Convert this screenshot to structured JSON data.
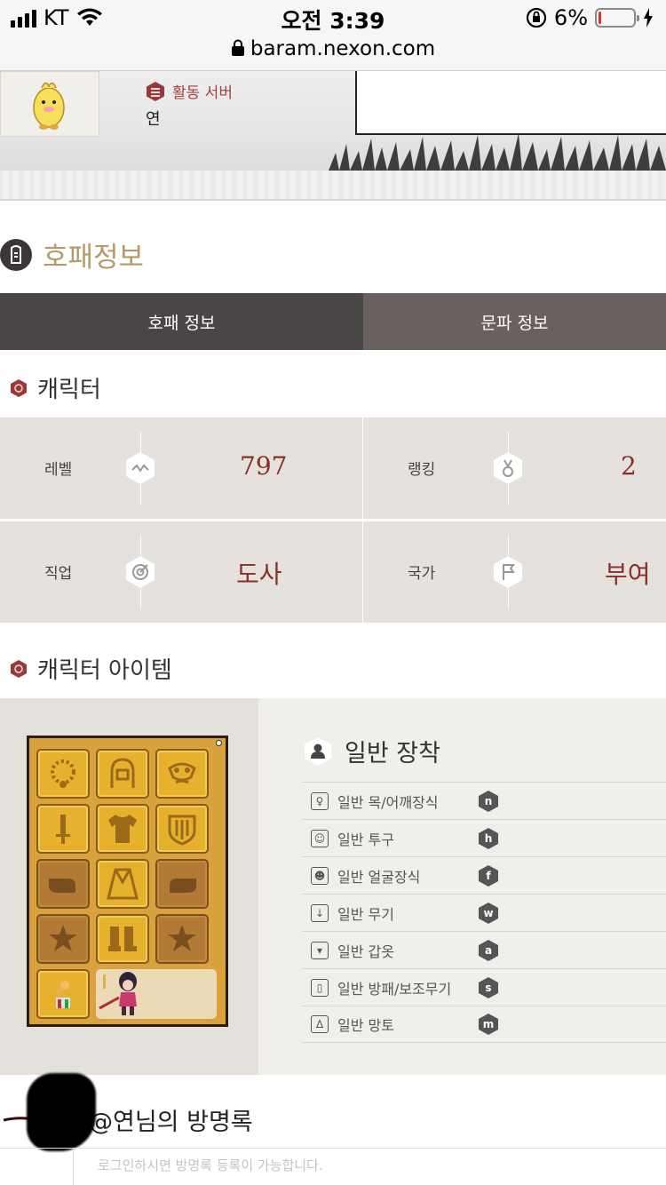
{
  "status_bar": {
    "carrier": "KT",
    "time": "오전 3:39",
    "battery_percent": "6%",
    "battery_level": 0.06
  },
  "browser": {
    "url": "baram.nexon.com"
  },
  "header": {
    "server_label": "활동 서버",
    "server_name": "연"
  },
  "section": {
    "title": "호패정보"
  },
  "tabs": [
    {
      "label": "호패 정보",
      "active": true
    },
    {
      "label": "문파 정보",
      "active": false
    }
  ],
  "character": {
    "heading": "캐릭터",
    "stats": [
      {
        "label": "레벨",
        "value": "797",
        "icon": "activity-icon"
      },
      {
        "label": "랭킹",
        "value": "2",
        "icon": "medal-icon"
      },
      {
        "label": "직업",
        "value": "도사",
        "icon": "target-icon"
      },
      {
        "label": "국가",
        "value": "부여",
        "icon": "flag-icon"
      }
    ]
  },
  "items": {
    "heading": "캐릭터 아이템",
    "equip_title": "일반 장착",
    "equip_rows": [
      {
        "label": "일반 목/어깨장식",
        "key": "n",
        "icon": "necklace-icon"
      },
      {
        "label": "일반 투구",
        "key": "h",
        "icon": "helmet-icon"
      },
      {
        "label": "일반 얼굴장식",
        "key": "f",
        "icon": "face-icon"
      },
      {
        "label": "일반 무기",
        "key": "w",
        "icon": "sword-icon"
      },
      {
        "label": "일반 갑옷",
        "key": "a",
        "icon": "armor-icon"
      },
      {
        "label": "일반 방패/보조무기",
        "key": "s",
        "icon": "shield-icon"
      },
      {
        "label": "일반 망토",
        "key": "m",
        "icon": "cloak-icon"
      }
    ]
  },
  "guestbook": {
    "title": "@연님의 방명록",
    "placeholder": "로그인하시면 방명록 등록이 가능합니다."
  },
  "colors": {
    "accent_red": "#8a2e2c",
    "gold_title": "#b49a6a",
    "tab_active": "#4a4646"
  }
}
